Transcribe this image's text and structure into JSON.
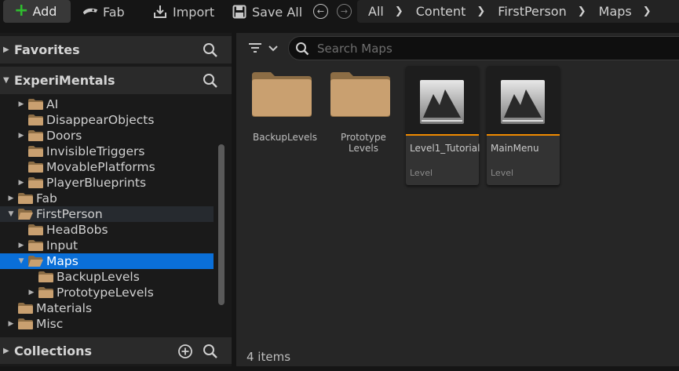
{
  "toolbar": {
    "add_label": "Add",
    "fab_label": "Fab",
    "import_label": "Import",
    "save_all_label": "Save All",
    "accent_add": "#2fbd2f"
  },
  "breadcrumb": [
    "All",
    "Content",
    "FirstPerson",
    "Maps"
  ],
  "left_panel": {
    "favorites_label": "Favorites",
    "project_label": "ExperiMentals",
    "collections_label": "Collections",
    "tree": [
      {
        "label": "AI",
        "expandable": true,
        "open": false
      },
      {
        "label": "DisappearObjects",
        "expandable": false,
        "open": false
      },
      {
        "label": "Doors",
        "expandable": true,
        "open": false
      },
      {
        "label": "InvisibleTriggers",
        "expandable": false,
        "open": false
      },
      {
        "label": "MovablePlatforms",
        "expandable": false,
        "open": false
      },
      {
        "label": "PlayerBlueprints",
        "expandable": true,
        "open": false
      },
      {
        "label": "Fab",
        "expandable": true,
        "open": false
      },
      {
        "label": "FirstPerson",
        "expandable": true,
        "open": true
      },
      {
        "label": "HeadBobs",
        "expandable": false,
        "open": false
      },
      {
        "label": "Input",
        "expandable": true,
        "open": false
      },
      {
        "label": "Maps",
        "expandable": true,
        "open": true,
        "selected": true
      },
      {
        "label": "BackupLevels",
        "expandable": false,
        "open": false
      },
      {
        "label": "PrototypeLevels",
        "expandable": true,
        "open": false
      },
      {
        "label": "Materials",
        "expandable": false,
        "open": false
      },
      {
        "label": "Misc",
        "expandable": true,
        "open": false
      }
    ]
  },
  "search": {
    "placeholder": "Search Maps"
  },
  "content": {
    "folders": [
      {
        "label": "BackupLevels"
      },
      {
        "label": "Prototype Levels"
      }
    ],
    "assets": [
      {
        "name": "Level1_Tutorial",
        "type": "Level"
      },
      {
        "name": "MainMenu",
        "type": "Level"
      }
    ],
    "item_count": "4 items",
    "accent_level": "#f08a00",
    "selection_color": "#0a6fd8"
  }
}
